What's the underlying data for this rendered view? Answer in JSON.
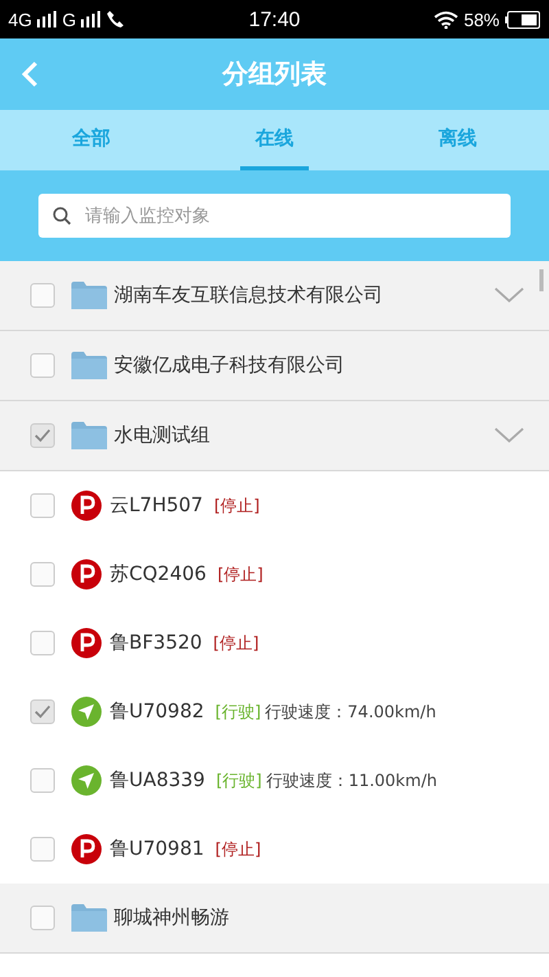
{
  "status_bar": {
    "network_1": "4G",
    "network_2": "G",
    "time": "17:40",
    "battery": "58%"
  },
  "header": {
    "title": "分组列表"
  },
  "tabs": [
    {
      "label": "全部",
      "selected": false
    },
    {
      "label": "在线",
      "selected": true
    },
    {
      "label": "离线",
      "selected": false
    }
  ],
  "search": {
    "placeholder": "请输入监控对象"
  },
  "items": [
    {
      "kind": "group",
      "name": "湖南车友互联信息技术有限公司",
      "checked": false,
      "expandable": true
    },
    {
      "kind": "group",
      "name": "安徽亿成电子科技有限公司",
      "checked": false,
      "expandable": false
    },
    {
      "kind": "group",
      "name": "水电测试组",
      "checked": true,
      "expandable": true
    },
    {
      "kind": "stopped",
      "plate": "云L7H507",
      "status_text": "[停止]",
      "checked": false
    },
    {
      "kind": "stopped",
      "plate": "苏CQ2406",
      "status_text": "[停止]",
      "checked": false
    },
    {
      "kind": "stopped",
      "plate": "鲁BF3520",
      "status_text": "[停止]",
      "checked": false
    },
    {
      "kind": "moving",
      "plate": "鲁U70982",
      "status_text": "[行驶]",
      "speed": "行驶速度：74.00km/h",
      "checked": true
    },
    {
      "kind": "moving",
      "plate": "鲁UA8339",
      "status_text": "[行驶]",
      "speed": "行驶速度：11.00km/h",
      "checked": false
    },
    {
      "kind": "stopped",
      "plate": "鲁U70981",
      "status_text": "[停止]",
      "checked": false
    },
    {
      "kind": "group",
      "name": "聊城神州畅游",
      "checked": false,
      "expandable": false
    }
  ]
}
